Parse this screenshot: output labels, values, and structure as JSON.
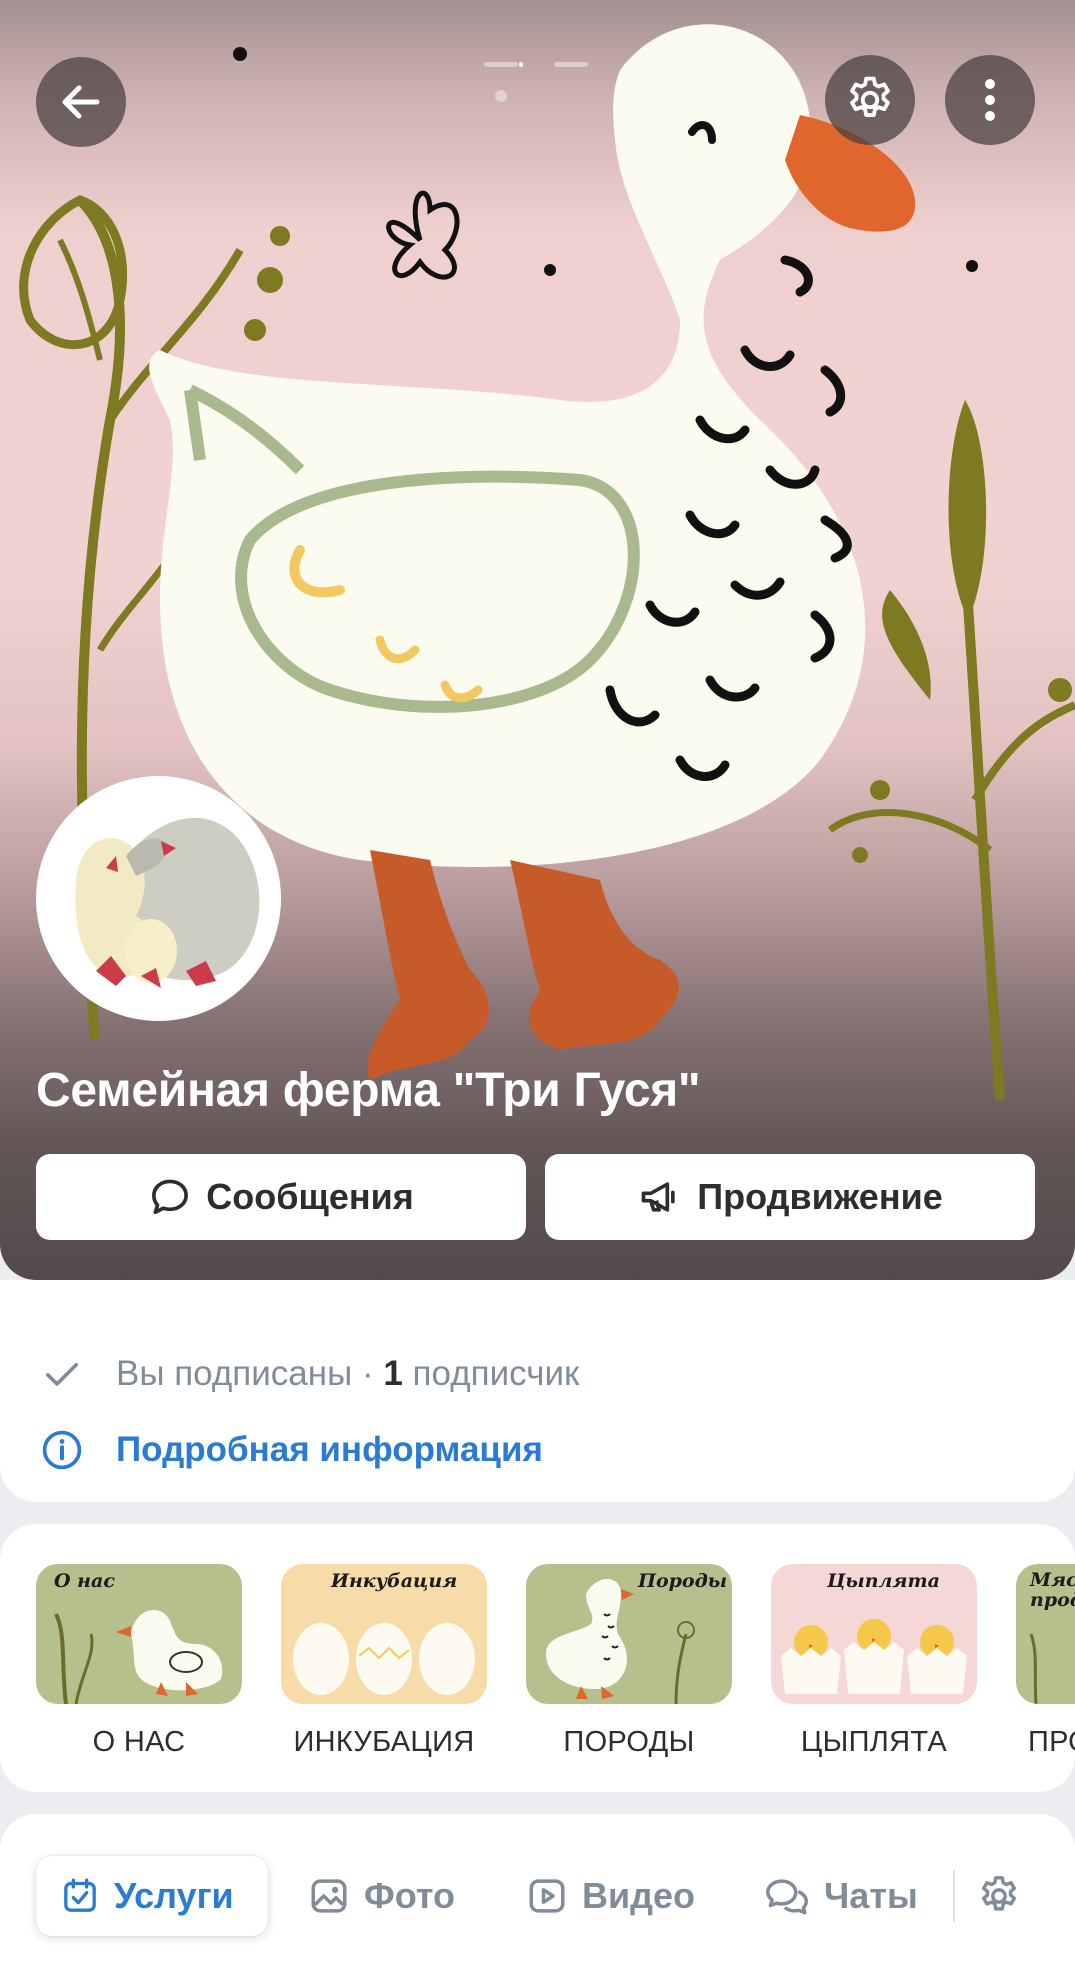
{
  "colors": {
    "accent": "#2a7bd3",
    "text_primary": "#2c2d2e",
    "text_secondary": "#818c99",
    "surface": "#ffffff",
    "background": "#ebedf0"
  },
  "header": {
    "back_icon": "arrow-left-icon",
    "settings_icon": "gear-icon",
    "more_icon": "more-vertical-icon",
    "cover_pages": 3,
    "cover_active_page": 2
  },
  "group": {
    "title": "Семейная ферма \"Три Гуся\"",
    "avatar_icon": "geese-logo"
  },
  "actions": {
    "messages_label": "Сообщения",
    "messages_icon": "chat-bubble-icon",
    "promote_label": "Продвижение",
    "promote_icon": "megaphone-icon"
  },
  "info": {
    "subscribed_text": "Вы подписаны",
    "separator": " · ",
    "subscriber_count": "1",
    "subscriber_word": " подписчик",
    "details_link": "Подробная информация"
  },
  "categories": [
    {
      "caption": "О НАС",
      "thumb_title": "О нас"
    },
    {
      "caption": "ИНКУБАЦИЯ",
      "thumb_title": "Инкубация"
    },
    {
      "caption": "ПОРОДЫ",
      "thumb_title": "Породы"
    },
    {
      "caption": "ЦЫПЛЯТА",
      "thumb_title": "Цыплята"
    },
    {
      "caption": "ПРО",
      "thumb_title": "Мяс прод"
    }
  ],
  "tabs": [
    {
      "label": "Услуги",
      "icon": "calendar-check-icon",
      "active": true
    },
    {
      "label": "Фото",
      "icon": "image-icon",
      "active": false
    },
    {
      "label": "Видео",
      "icon": "play-icon",
      "active": false
    },
    {
      "label": "Чаты",
      "icon": "chats-icon",
      "active": false
    }
  ],
  "tabs_settings_icon": "gear-icon"
}
